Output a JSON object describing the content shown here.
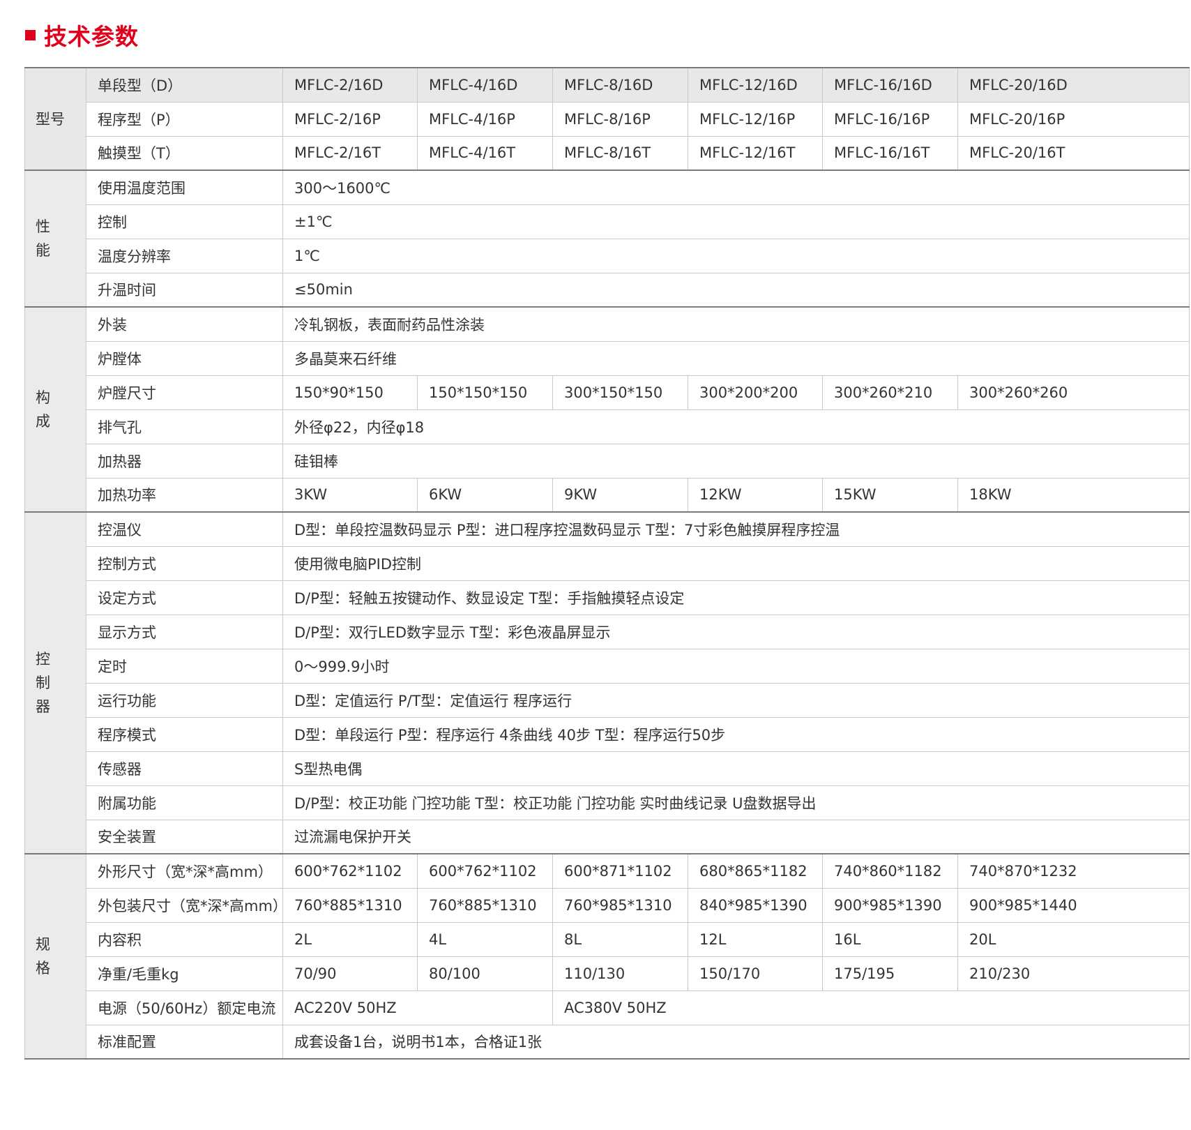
{
  "heading": "技术参数",
  "colors": {
    "accent": "#e0001b",
    "header_bg": "#e8e8e8",
    "group_bg": "#ebebeb",
    "rule": "#7a7a7a"
  },
  "model": {
    "group": "型号",
    "rows": [
      {
        "label": "单段型（D）",
        "cells": [
          "MFLC-2/16D",
          "MFLC-4/16D",
          "MFLC-8/16D",
          "MFLC-12/16D",
          "MFLC-16/16D",
          "MFLC-20/16D"
        ]
      },
      {
        "label": "程序型（P）",
        "cells": [
          "MFLC-2/16P",
          "MFLC-4/16P",
          "MFLC-8/16P",
          "MFLC-12/16P",
          "MFLC-16/16P",
          "MFLC-20/16P"
        ]
      },
      {
        "label": "触摸型（T）",
        "cells": [
          "MFLC-2/16T",
          "MFLC-4/16T",
          "MFLC-8/16T",
          "MFLC-12/16T",
          "MFLC-16/16T",
          "MFLC-20/16T"
        ]
      }
    ]
  },
  "performance": {
    "group": [
      "性",
      "能"
    ],
    "rows": [
      {
        "label": "使用温度范围",
        "value": "300～1600℃"
      },
      {
        "label": "控制",
        "value": "±1℃"
      },
      {
        "label": "温度分辨率",
        "value": "1℃"
      },
      {
        "label": "升温时间",
        "value": "≤50min"
      }
    ]
  },
  "construction": {
    "group": [
      "构",
      "成"
    ],
    "rows": [
      {
        "label": "外装",
        "value": "冷轧钢板，表面耐药品性涂装"
      },
      {
        "label": "炉膛体",
        "value": "多晶莫来石纤维"
      },
      {
        "label": "炉膛尺寸",
        "cells": [
          "150*90*150",
          "150*150*150",
          "300*150*150",
          "300*200*200",
          "300*260*210",
          "300*260*260"
        ]
      },
      {
        "label": "排气孔",
        "value": "外径φ22，内径φ18"
      },
      {
        "label": "加热器",
        "value": "硅钼棒"
      },
      {
        "label": "加热功率",
        "cells": [
          "3KW",
          "6KW",
          "9KW",
          "12KW",
          "15KW",
          "18KW"
        ]
      }
    ]
  },
  "controller": {
    "group": [
      "控",
      "制",
      "器"
    ],
    "rows": [
      {
        "label": "控温仪",
        "value": "D型：单段控温数码显示 P型：进口程序控温数码显示 T型：7寸彩色触摸屏程序控温"
      },
      {
        "label": "控制方式",
        "value": "使用微电脑PID控制"
      },
      {
        "label": "设定方式",
        "value": "D/P型：轻触五按键动作、数显设定  T型：手指触摸轻点设定"
      },
      {
        "label": "显示方式",
        "value": "D/P型：双行LED数字显示  T型：彩色液晶屏显示"
      },
      {
        "label": "定时",
        "value": "0～999.9小时"
      },
      {
        "label": "运行功能",
        "value": "D型：定值运行  P/T型：定值运行 程序运行"
      },
      {
        "label": "程序模式",
        "value": "D型：单段运行  P型：程序运行 4条曲线 40步  T型：程序运行50步"
      },
      {
        "label": "传感器",
        "value": "S型热电偶"
      },
      {
        "label": "附属功能",
        "value": "D/P型：校正功能 门控功能  T型：校正功能 门控功能 实时曲线记录 U盘数据导出"
      },
      {
        "label": "安全装置",
        "value": "过流漏电保护开关"
      }
    ]
  },
  "specs": {
    "group": [
      "规",
      "格"
    ],
    "rows": [
      {
        "label": "外形尺寸（宽*深*高mm）",
        "cells": [
          "600*762*1102",
          "600*762*1102",
          "600*871*1102",
          "680*865*1182",
          "740*860*1182",
          "740*870*1232"
        ]
      },
      {
        "label": "外包装尺寸（宽*深*高mm）",
        "cells": [
          "760*885*1310",
          "760*885*1310",
          "760*985*1310",
          "840*985*1390",
          "900*985*1390",
          "900*985*1440"
        ]
      },
      {
        "label": "内容积",
        "cells": [
          "2L",
          "4L",
          "8L",
          "12L",
          "16L",
          "20L"
        ]
      },
      {
        "label": "净重/毛重kg",
        "cells": [
          "70/90",
          "80/100",
          "110/130",
          "150/170",
          "175/195",
          "210/230"
        ]
      },
      {
        "label": "电源（50/60Hz）额定电流",
        "cells": [
          "AC220V  50HZ",
          "AC380V  50HZ"
        ]
      },
      {
        "label": "标准配置",
        "value": "成套设备1台，说明书1本，合格证1张"
      }
    ]
  }
}
